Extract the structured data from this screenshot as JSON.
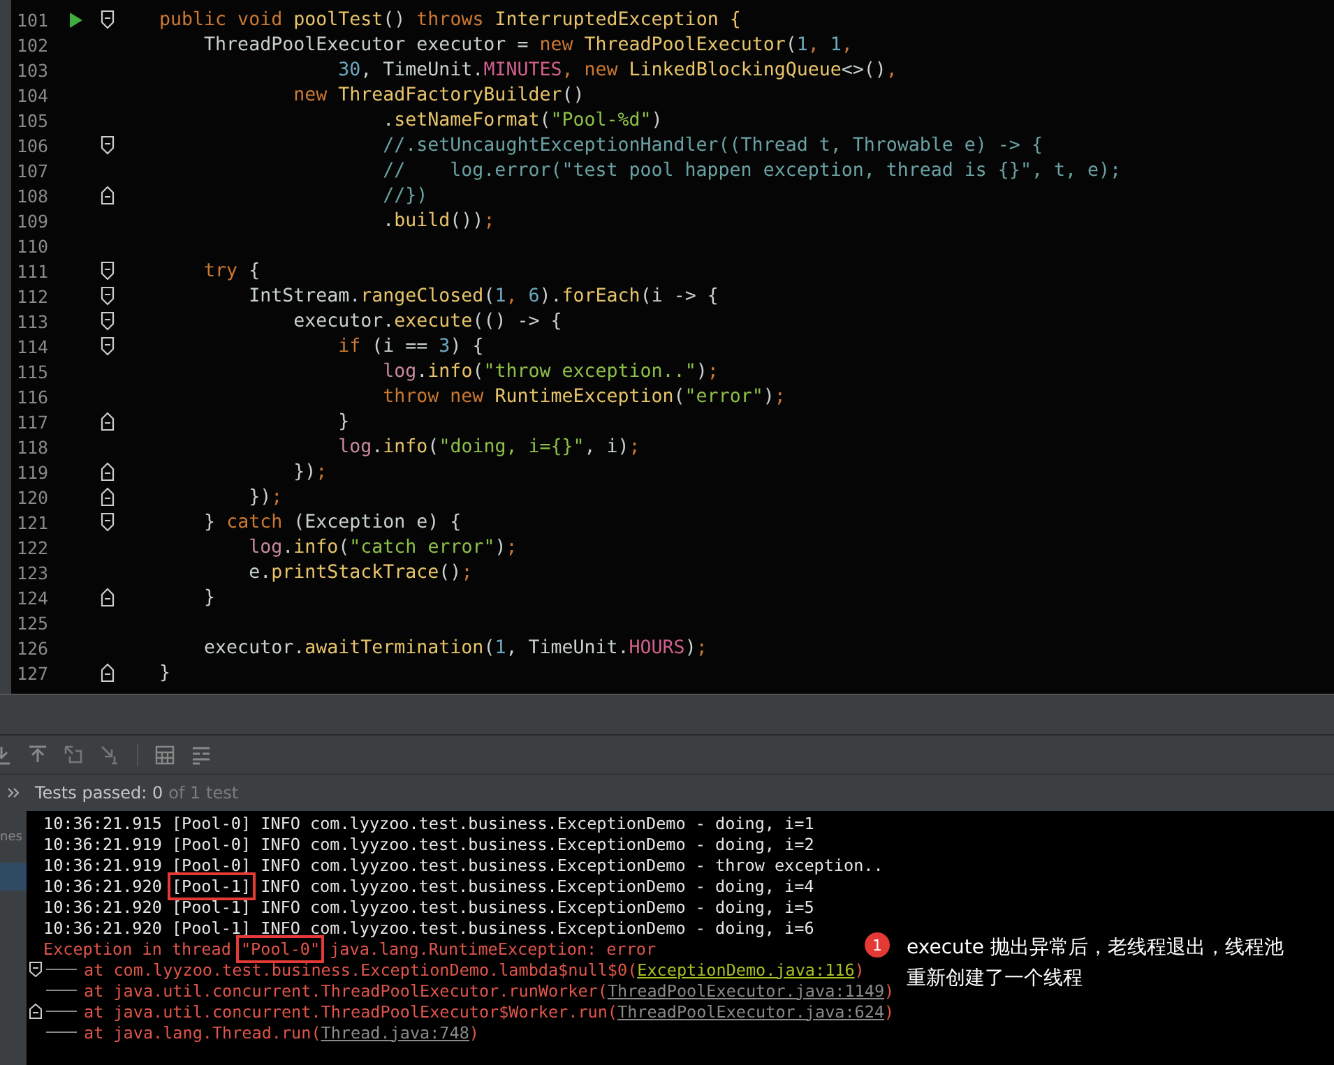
{
  "editor": {
    "lines": [
      {
        "num": "101",
        "run_marker": true,
        "fold_start": true,
        "fold_end": false,
        "tokens": [
          {
            "text": "    public void ",
            "kind": "keyword"
          },
          {
            "text": "poolTest",
            "kind": "method"
          },
          {
            "text": "() ",
            "kind": "plain"
          },
          {
            "text": "throws ",
            "kind": "keyword"
          },
          {
            "text": "InterruptedException {",
            "kind": "method"
          }
        ]
      },
      {
        "num": "102",
        "run_marker": false,
        "fold_start": false,
        "fold_end": false,
        "tokens": [
          {
            "text": "        ThreadPoolExecutor executor = ",
            "kind": "plain"
          },
          {
            "text": "new ",
            "kind": "keyword"
          },
          {
            "text": "ThreadPoolExecutor",
            "kind": "method"
          },
          {
            "text": "(",
            "kind": "plain"
          },
          {
            "text": "1",
            "kind": "number"
          },
          {
            "text": ", ",
            "kind": "keyword"
          },
          {
            "text": "1",
            "kind": "number"
          },
          {
            "text": ",",
            "kind": "keyword"
          }
        ]
      },
      {
        "num": "103",
        "run_marker": false,
        "fold_start": false,
        "fold_end": false,
        "tokens": [
          {
            "text": "                    30",
            "kind": "number"
          },
          {
            "text": ", TimeUnit.",
            "kind": "plain"
          },
          {
            "text": "MINUTES",
            "kind": "constant"
          },
          {
            "text": ", new ",
            "kind": "keyword"
          },
          {
            "text": "LinkedBlockingQueue",
            "kind": "method"
          },
          {
            "text": "<>()",
            "kind": "plain"
          },
          {
            "text": ",",
            "kind": "keyword"
          }
        ]
      },
      {
        "num": "104",
        "run_marker": false,
        "fold_start": false,
        "fold_end": false,
        "tokens": [
          {
            "text": "                new ",
            "kind": "keyword"
          },
          {
            "text": "ThreadFactoryBuilder",
            "kind": "method"
          },
          {
            "text": "()",
            "kind": "plain"
          }
        ]
      },
      {
        "num": "105",
        "run_marker": false,
        "fold_start": false,
        "fold_end": false,
        "tokens": [
          {
            "text": "                        .",
            "kind": "plain"
          },
          {
            "text": "setNameFormat",
            "kind": "method"
          },
          {
            "text": "(",
            "kind": "plain"
          },
          {
            "text": "\"Pool-%d\"",
            "kind": "string"
          },
          {
            "text": ")",
            "kind": "plain"
          }
        ]
      },
      {
        "num": "106",
        "run_marker": false,
        "fold_start": true,
        "fold_end": false,
        "tokens": [
          {
            "text": "                        //.setUncaughtExceptionHandler((Thread t, Throwable e) -> {",
            "kind": "comment"
          }
        ]
      },
      {
        "num": "107",
        "run_marker": false,
        "fold_start": false,
        "fold_end": false,
        "tokens": [
          {
            "text": "                        //    log.error(\"test pool happen exception, thread is {}\", t, e);",
            "kind": "comment"
          }
        ]
      },
      {
        "num": "108",
        "run_marker": false,
        "fold_start": false,
        "fold_end": true,
        "tokens": [
          {
            "text": "                        //})",
            "kind": "comment"
          }
        ]
      },
      {
        "num": "109",
        "run_marker": false,
        "fold_start": false,
        "fold_end": false,
        "tokens": [
          {
            "text": "                        .",
            "kind": "plain"
          },
          {
            "text": "build",
            "kind": "method"
          },
          {
            "text": "())",
            "kind": "plain"
          },
          {
            "text": ";",
            "kind": "keyword"
          }
        ]
      },
      {
        "num": "110",
        "run_marker": false,
        "fold_start": false,
        "fold_end": false
      },
      {
        "num": "111",
        "run_marker": false,
        "fold_start": true,
        "fold_end": false,
        "tokens": [
          {
            "text": "        try ",
            "kind": "keyword"
          },
          {
            "text": "{",
            "kind": "plain"
          }
        ]
      },
      {
        "num": "112",
        "run_marker": false,
        "fold_start": true,
        "fold_end": false,
        "tokens": [
          {
            "text": "            IntStream.",
            "kind": "plain"
          },
          {
            "text": "rangeClosed",
            "kind": "method"
          },
          {
            "text": "(",
            "kind": "plain"
          },
          {
            "text": "1",
            "kind": "number"
          },
          {
            "text": ", ",
            "kind": "keyword"
          },
          {
            "text": "6",
            "kind": "number"
          },
          {
            "text": ").",
            "kind": "plain"
          },
          {
            "text": "forEach",
            "kind": "method"
          },
          {
            "text": "(i -> {",
            "kind": "plain"
          }
        ]
      },
      {
        "num": "113",
        "run_marker": false,
        "fold_start": true,
        "fold_end": false,
        "tokens": [
          {
            "text": "                executor.",
            "kind": "plain"
          },
          {
            "text": "execute",
            "kind": "method"
          },
          {
            "text": "(() -> {",
            "kind": "plain"
          }
        ]
      },
      {
        "num": "114",
        "run_marker": false,
        "fold_start": true,
        "fold_end": false,
        "tokens": [
          {
            "text": "                    if ",
            "kind": "keyword"
          },
          {
            "text": "(i == ",
            "kind": "plain"
          },
          {
            "text": "3",
            "kind": "number"
          },
          {
            "text": ") {",
            "kind": "plain"
          }
        ]
      },
      {
        "num": "115",
        "run_marker": false,
        "fold_start": false,
        "fold_end": false,
        "tokens": [
          {
            "text": "                        log",
            "kind": "field"
          },
          {
            "text": ".",
            "kind": "plain"
          },
          {
            "text": "info",
            "kind": "method"
          },
          {
            "text": "(",
            "kind": "plain"
          },
          {
            "text": "\"throw exception..\"",
            "kind": "string"
          },
          {
            "text": ")",
            "kind": "plain"
          },
          {
            "text": ";",
            "kind": "keyword"
          }
        ]
      },
      {
        "num": "116",
        "run_marker": false,
        "fold_start": false,
        "fold_end": false,
        "tokens": [
          {
            "text": "                        throw new ",
            "kind": "keyword"
          },
          {
            "text": "RuntimeException",
            "kind": "method"
          },
          {
            "text": "(",
            "kind": "plain"
          },
          {
            "text": "\"error\"",
            "kind": "string"
          },
          {
            "text": ")",
            "kind": "plain"
          },
          {
            "text": ";",
            "kind": "keyword"
          }
        ]
      },
      {
        "num": "117",
        "run_marker": false,
        "fold_start": false,
        "fold_end": true,
        "tokens": [
          {
            "text": "                    }",
            "kind": "plain"
          }
        ]
      },
      {
        "num": "118",
        "run_marker": false,
        "fold_start": false,
        "fold_end": false,
        "tokens": [
          {
            "text": "                    log",
            "kind": "field"
          },
          {
            "text": ".",
            "kind": "plain"
          },
          {
            "text": "info",
            "kind": "method"
          },
          {
            "text": "(",
            "kind": "plain"
          },
          {
            "text": "\"doing, i={}\"",
            "kind": "string"
          },
          {
            "text": ", i)",
            "kind": "plain"
          },
          {
            "text": ";",
            "kind": "keyword"
          }
        ]
      },
      {
        "num": "119",
        "run_marker": false,
        "fold_start": false,
        "fold_end": true,
        "tokens": [
          {
            "text": "                })",
            "kind": "plain"
          },
          {
            "text": ";",
            "kind": "keyword"
          }
        ]
      },
      {
        "num": "120",
        "run_marker": false,
        "fold_start": false,
        "fold_end": true,
        "tokens": [
          {
            "text": "            })",
            "kind": "plain"
          },
          {
            "text": ";",
            "kind": "keyword"
          }
        ]
      },
      {
        "num": "121",
        "run_marker": false,
        "fold_start": true,
        "fold_end": false,
        "tokens": [
          {
            "text": "        } ",
            "kind": "plain"
          },
          {
            "text": "catch ",
            "kind": "keyword"
          },
          {
            "text": "(Exception e) {",
            "kind": "plain"
          }
        ]
      },
      {
        "num": "122",
        "run_marker": false,
        "fold_start": false,
        "fold_end": false,
        "tokens": [
          {
            "text": "            log",
            "kind": "field"
          },
          {
            "text": ".",
            "kind": "plain"
          },
          {
            "text": "info",
            "kind": "method"
          },
          {
            "text": "(",
            "kind": "plain"
          },
          {
            "text": "\"catch error\"",
            "kind": "string"
          },
          {
            "text": ")",
            "kind": "plain"
          },
          {
            "text": ";",
            "kind": "keyword"
          }
        ]
      },
      {
        "num": "123",
        "run_marker": false,
        "fold_start": false,
        "fold_end": false,
        "tokens": [
          {
            "text": "            e.",
            "kind": "plain"
          },
          {
            "text": "printStackTrace",
            "kind": "method"
          },
          {
            "text": "()",
            "kind": "plain"
          },
          {
            "text": ";",
            "kind": "keyword"
          }
        ]
      },
      {
        "num": "124",
        "run_marker": false,
        "fold_start": false,
        "fold_end": true,
        "tokens": [
          {
            "text": "        }",
            "kind": "plain"
          }
        ]
      },
      {
        "num": "125",
        "run_marker": false,
        "fold_start": false,
        "fold_end": false
      },
      {
        "num": "126",
        "run_marker": false,
        "fold_start": false,
        "fold_end": false,
        "tokens": [
          {
            "text": "        executor.",
            "kind": "plain"
          },
          {
            "text": "awaitTermination",
            "kind": "method"
          },
          {
            "text": "(",
            "kind": "plain"
          },
          {
            "text": "1",
            "kind": "number"
          },
          {
            "text": ", TimeUnit.",
            "kind": "plain"
          },
          {
            "text": "HOURS",
            "kind": "constant"
          },
          {
            "text": ")",
            "kind": "plain"
          },
          {
            "text": ";",
            "kind": "keyword"
          }
        ]
      },
      {
        "num": "127",
        "run_marker": false,
        "fold_start": false,
        "fold_end": true,
        "tokens": [
          {
            "text": "    }",
            "kind": "plain"
          }
        ]
      }
    ]
  },
  "side_panel": {
    "label": "nes"
  },
  "tests": {
    "result": "Tests passed: 0",
    "total": "of 1 test"
  },
  "console": {
    "lines": [
      {
        "kind": "log",
        "fold_start": false,
        "fold_end": false,
        "segments": [
          {
            "text": "10:36:21.915 [Pool-0] INFO com.lyyzoo.test.business.ExceptionDemo - doing, i=1",
            "kind": "output",
            "boxed": false
          }
        ]
      },
      {
        "kind": "log",
        "fold_start": false,
        "fold_end": false,
        "segments": [
          {
            "text": "10:36:21.919 [Pool-0] INFO com.lyyzoo.test.business.ExceptionDemo - doing, i=2",
            "kind": "output",
            "boxed": false
          }
        ]
      },
      {
        "kind": "log",
        "fold_start": false,
        "fold_end": false,
        "segments": [
          {
            "text": "10:36:21.919 [Pool-0] INFO com.lyyzoo.test.business.ExceptionDemo - throw exception..",
            "kind": "output",
            "boxed": false
          }
        ]
      },
      {
        "kind": "log",
        "fold_start": false,
        "fold_end": false,
        "segments": [
          {
            "text": "10:36:21.920",
            "kind": "output",
            "boxed": false
          },
          {
            "text": "[Pool-1]",
            "kind": "output",
            "boxed": true
          },
          {
            "text": "INFO com.lyyzoo.test.business.ExceptionDemo - doing, i=4",
            "kind": "output",
            "boxed": false
          }
        ]
      },
      {
        "kind": "log",
        "fold_start": false,
        "fold_end": false,
        "segments": [
          {
            "text": "10:36:21.920 [Pool-1] INFO com.lyyzoo.test.business.ExceptionDemo - doing, i=5",
            "kind": "output",
            "boxed": false
          }
        ]
      },
      {
        "kind": "log",
        "fold_start": false,
        "fold_end": false,
        "segments": [
          {
            "text": "10:36:21.920 [Pool-1] INFO com.lyyzoo.test.business.ExceptionDemo - doing, i=6",
            "kind": "output",
            "boxed": false
          }
        ]
      },
      {
        "kind": "log",
        "fold_start": false,
        "fold_end": false,
        "segments": [
          {
            "text": "Exception in thread",
            "kind": "error",
            "boxed": false
          },
          {
            "text": "\"Pool-0\"",
            "kind": "error",
            "boxed": true
          },
          {
            "text": "java.lang.RuntimeException: error",
            "kind": "error",
            "boxed": false
          }
        ]
      },
      {
        "kind": "stack",
        "fold_start": true,
        "fold_end": false,
        "segments": [
          {
            "text": "at com.lyyzoo.test.business.ExceptionDemo.lambda$null$0(",
            "kind": "error",
            "boxed": false
          },
          {
            "text": "ExceptionDemo.java:116",
            "kind": "link",
            "boxed": false
          },
          {
            "text": ")",
            "kind": "error",
            "boxed": false
          }
        ]
      },
      {
        "kind": "stack",
        "fold_start": false,
        "fold_end": false,
        "segments": [
          {
            "text": "at java.util.concurrent.ThreadPoolExecutor.runWorker(",
            "kind": "error",
            "boxed": false
          },
          {
            "text": "ThreadPoolExecutor.java:1149",
            "kind": "library_link",
            "boxed": false
          },
          {
            "text": ")",
            "kind": "error",
            "boxed": false
          }
        ]
      },
      {
        "kind": "stack",
        "fold_start": false,
        "fold_end": true,
        "segments": [
          {
            "text": "at java.util.concurrent.ThreadPoolExecutor$Worker.run(",
            "kind": "error",
            "boxed": false
          },
          {
            "text": "ThreadPoolExecutor.java:624",
            "kind": "library_link",
            "boxed": false
          },
          {
            "text": ")",
            "kind": "error",
            "boxed": false
          }
        ]
      },
      {
        "kind": "stack",
        "fold_start": false,
        "fold_end": false,
        "segments": [
          {
            "text": "at java.lang.Thread.run(",
            "kind": "error",
            "boxed": false
          },
          {
            "text": "Thread.java:748",
            "kind": "library_link",
            "boxed": false
          },
          {
            "text": ")",
            "kind": "error",
            "boxed": false
          }
        ]
      }
    ]
  },
  "annotation": {
    "badge": "1",
    "lines": [
      "execute 抛出异常后，老线程退出，线程池",
      "重新创建了一个线程"
    ]
  }
}
